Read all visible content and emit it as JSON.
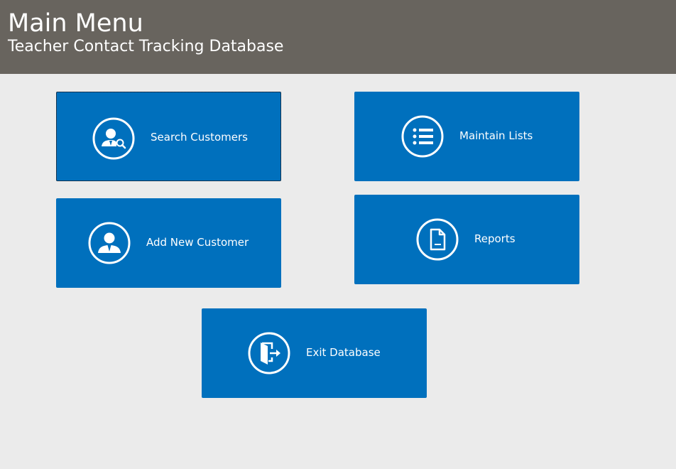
{
  "header": {
    "title": "Main Menu",
    "subtitle": "Teacher Contact Tracking Database"
  },
  "menu": {
    "search_customers": {
      "label": "Search Customers",
      "icon": "search-user-icon"
    },
    "maintain_lists": {
      "label": "Maintain Lists",
      "icon": "list-icon"
    },
    "add_new_customer": {
      "label": "Add New Customer",
      "icon": "user-icon"
    },
    "reports": {
      "label": "Reports",
      "icon": "document-icon"
    },
    "exit_database": {
      "label": "Exit Database",
      "icon": "exit-icon"
    }
  },
  "colors": {
    "header_bg": "#68645e",
    "page_bg": "#ebebeb",
    "tile_bg": "#0070bd",
    "text": "#ffffff"
  }
}
